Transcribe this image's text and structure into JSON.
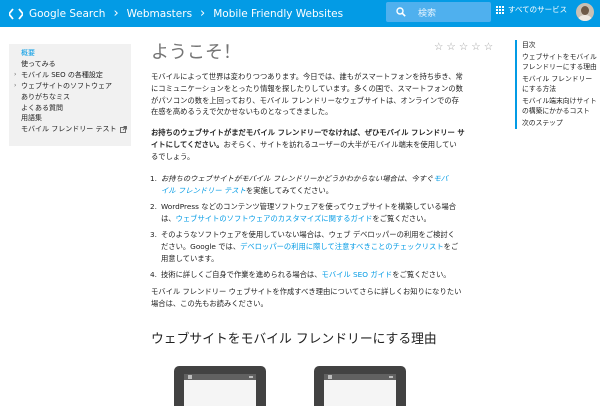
{
  "header": {
    "crumbs": [
      "Google Search",
      "Webmasters",
      "Mobile Friendly Websites"
    ],
    "search_placeholder": "検索",
    "apps_label": "すべてのサービス",
    "brand_color": "#039be5"
  },
  "leftnav": {
    "items": [
      {
        "label": "概要",
        "active": true,
        "expandable": false
      },
      {
        "label": "使ってみる",
        "active": false,
        "expandable": false
      },
      {
        "label": "モバイル SEO の各種設定",
        "active": false,
        "expandable": true
      },
      {
        "label": "ウェブサイトのソフトウェア",
        "active": false,
        "expandable": true
      },
      {
        "label": "ありがちなミス",
        "active": false,
        "expandable": false
      },
      {
        "label": "よくある質問",
        "active": false,
        "expandable": false
      },
      {
        "label": "用語集",
        "active": false,
        "expandable": false
      },
      {
        "label": "モバイル フレンドリー テスト",
        "active": false,
        "expandable": false,
        "external": true
      }
    ]
  },
  "main": {
    "title": "ようこそ！",
    "intro": {
      "line1": "モバイルによって世界は変わりつつあります。今日では、誰もがスマートフォンを持ち歩き、常",
      "line2": "にコミュニケーションをとったり情報を探したりしています。多くの国で、スマートフォンの数",
      "line3": "がパソコンの数を上回っており、モバイル フレンドリーなウェブサイトは、オンラインでの存",
      "line4": "在感を高めるうえで欠かせないものとなってきました。"
    },
    "p2": {
      "bold1": "お持ちのウェブサイトがまだモバイル フレンドリーでなければ、ぜひモバイル フレンドリー サ",
      "bold2": "イトにしてください。",
      "rest2": "おそらく、サイトを訪れるユーザーの大半がモバイル端末を使用してい",
      "line3": "るでしょう。"
    },
    "list": [
      {
        "num": "1.",
        "line1_text": "お持ちのウェブサイトがモバイル フレンドリーかどうかわからない場合は、今すぐ",
        "line1_link": "モバ",
        "line2_link": "イル フレンドリー テスト",
        "line2_text": "を実施してみてください。"
      },
      {
        "num": "2.",
        "line1_text": "WordPress などのコンテンツ管理ソフトウェアを使ってウェブサイトを構築している場合",
        "line2_pre": "は、",
        "line2_link": "ウェブサイトのソフトウェアのカスタマイズに関するガイド",
        "line2_text": "をご覧ください。"
      },
      {
        "num": "3.",
        "line1_text": "そのようなソフトウェアを使用していない場合は、ウェブ デベロッパーの利用をご検討く",
        "line2_pre": "ださい。Google では、",
        "line2_link": "デベロッパーの利用に際して注意すべきことのチェックリスト",
        "line2_text": "をご",
        "line3_text": "用意しています。"
      },
      {
        "num": "4.",
        "line1_text": "技術に詳しくご自身で作業を進められる場合は、",
        "line1_link": "モバイル SEO ガイド",
        "line1_post": "をご覧ください。"
      }
    ],
    "outro": {
      "line1": "モバイル フレンドリー ウェブサイトを作成すべき理由についてさらに詳しくお知りになりたい",
      "line2": "場合は、この先もお読みください。"
    },
    "section_heading": "ウェブサイトをモバイル フレンドリーにする理由"
  },
  "toc": {
    "heading": "目次",
    "items": [
      "ウェブサイトをモバイル フレンドリーにする理由",
      "モバイル フレンドリー にする方法",
      "モバイル端末向けサイトの構築にかかるコスト",
      "次のステップ"
    ],
    "items_display": [
      [
        "ウェブサイトをモバイル",
        "フレンドリーにする理由"
      ],
      [
        "モバイル フレンドリー",
        "にする方法"
      ],
      [
        "モバイル端末向けサイト",
        "の構築にかかるコスト"
      ],
      [
        "次のステップ"
      ]
    ]
  }
}
